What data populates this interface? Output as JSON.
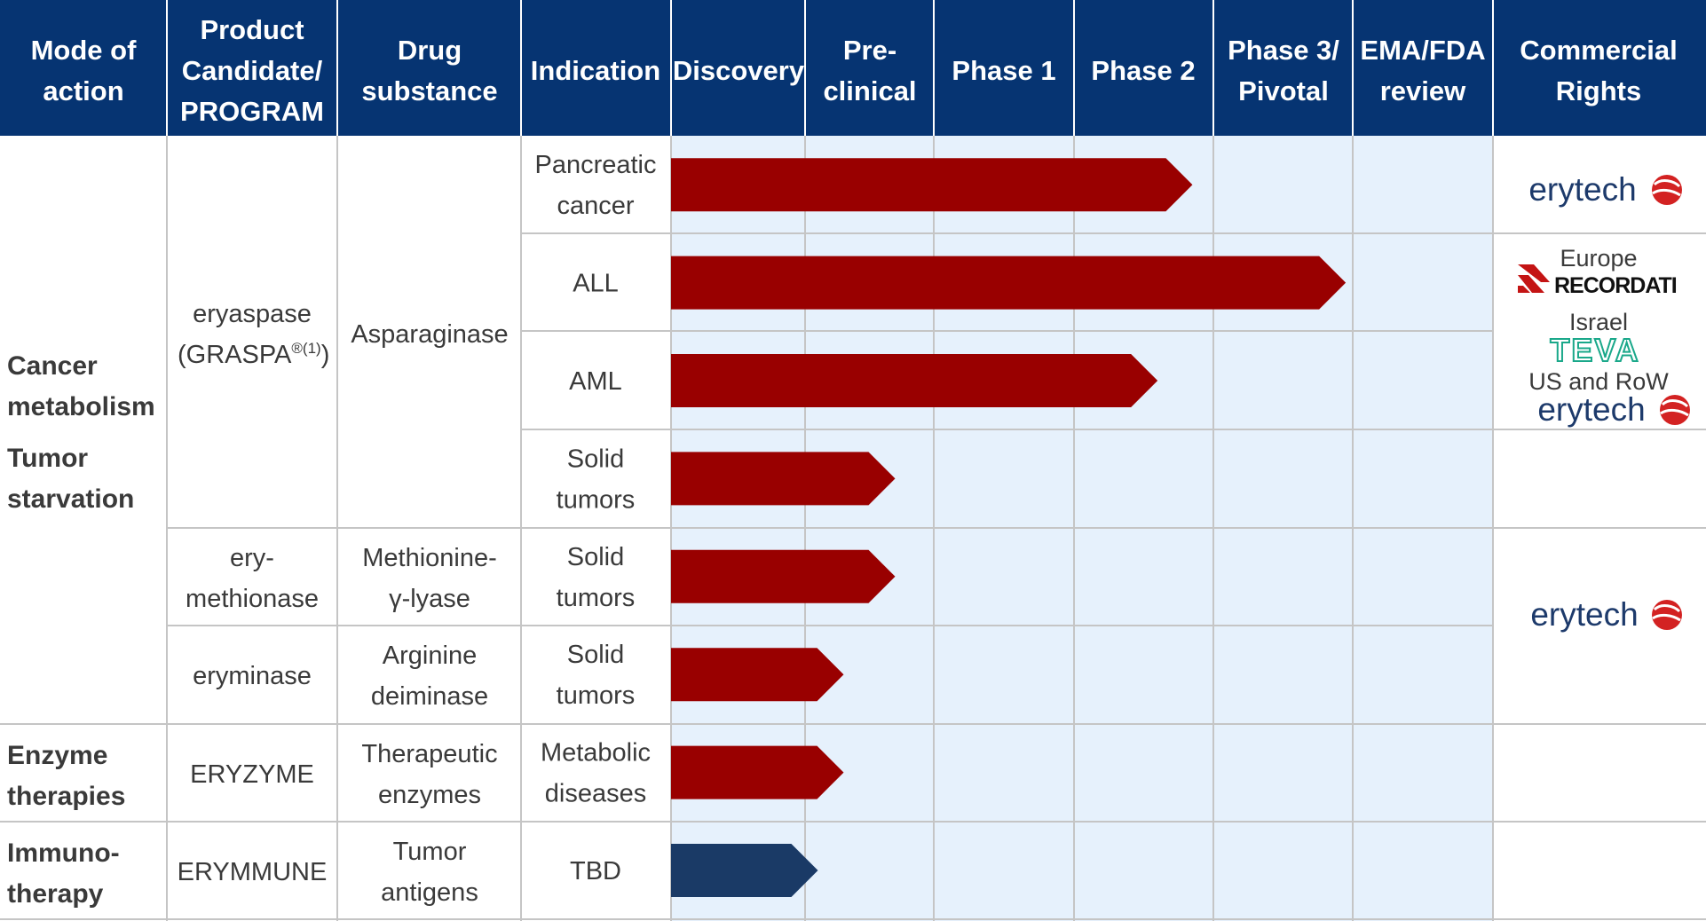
{
  "headers": {
    "mode": [
      "Mode of",
      "action"
    ],
    "product": [
      "Product",
      "Candidate/",
      "PROGRAM"
    ],
    "drug": [
      "Drug",
      "substance"
    ],
    "indication": [
      "Indication"
    ],
    "discovery": [
      "Discovery"
    ],
    "preclinical": [
      "Pre-",
      "clinical"
    ],
    "phase1": [
      "Phase 1"
    ],
    "phase2": [
      "Phase 2"
    ],
    "phase3": [
      "Phase 3/",
      "Pivotal"
    ],
    "review": [
      "EMA/FDA",
      "review"
    ],
    "rights": [
      "Commercial",
      "Rights"
    ]
  },
  "groups": {
    "cancer_line1": "Cancer",
    "cancer_line2": "metabolism",
    "tumor_line1": "Tumor",
    "tumor_line2": "starvation",
    "enzyme_line1": "Enzyme",
    "enzyme_line2": "therapies",
    "immuno_line1": "Immuno-",
    "immuno_line2": "therapy"
  },
  "products": {
    "eryaspase_line1": "eryaspase",
    "eryaspase_line2": "(GRASPA",
    "eryaspase_sup": "®(1)",
    "eryaspase_close": ")",
    "erymethionase_line1": "ery-",
    "erymethionase_line2": "methionase",
    "eryminase": "eryminase",
    "eryzyme": "ERYZYME",
    "erymmune": "ERYMMUNE"
  },
  "substances": {
    "asparaginase": "Asparaginase",
    "methionine_line1": "Methionine-",
    "methionine_line2": "γ-lyase",
    "arginine_line1": "Arginine",
    "arginine_line2": "deiminase",
    "therapeutic_line1": "Therapeutic",
    "therapeutic_line2": "enzymes",
    "tumor_antigens_line1": "Tumor",
    "tumor_antigens_line2": "antigens"
  },
  "rights": {
    "erytech_brand": "erytech",
    "europe_label": "Europe",
    "recordati_brand": "RECORDATI",
    "israel_label": "Israel",
    "teva_brand": "TEVA",
    "us_row_label": "US and RoW"
  },
  "colors": {
    "header_bg": "#063472",
    "phase_area_bg": "#e6f1fc",
    "bar_red": "#990000",
    "bar_navy": "#1a3a66",
    "grid": "#c5c5c5",
    "erytech_blue": "#1d3a6b",
    "erytech_red": "#d32222",
    "teva_green": "#1aa88a"
  },
  "chart_data": {
    "type": "bar",
    "stages": [
      "Discovery",
      "Pre-clinical",
      "Phase 1",
      "Phase 2",
      "Phase 3/ Pivotal",
      "EMA/FDA review"
    ],
    "progress_unit": "stage columns completed from start of Discovery",
    "rows": [
      {
        "indication": [
          "Pancreatic",
          "cancer"
        ],
        "progress": 3.85,
        "color": "#990000"
      },
      {
        "indication": [
          "ALL"
        ],
        "progress": 4.95,
        "color": "#990000"
      },
      {
        "indication": [
          "AML"
        ],
        "progress": 3.6,
        "color": "#990000"
      },
      {
        "indication": [
          "Solid",
          "tumors"
        ],
        "progress": 1.7,
        "color": "#990000"
      },
      {
        "indication": [
          "Solid",
          "tumors"
        ],
        "progress": 1.7,
        "color": "#990000"
      },
      {
        "indication": [
          "Solid",
          "tumors"
        ],
        "progress": 1.3,
        "color": "#990000"
      },
      {
        "indication": [
          "Metabolic",
          "diseases"
        ],
        "progress": 1.3,
        "color": "#990000"
      },
      {
        "indication": [
          "TBD"
        ],
        "progress": 1.1,
        "color": "#1a3a66"
      }
    ]
  }
}
